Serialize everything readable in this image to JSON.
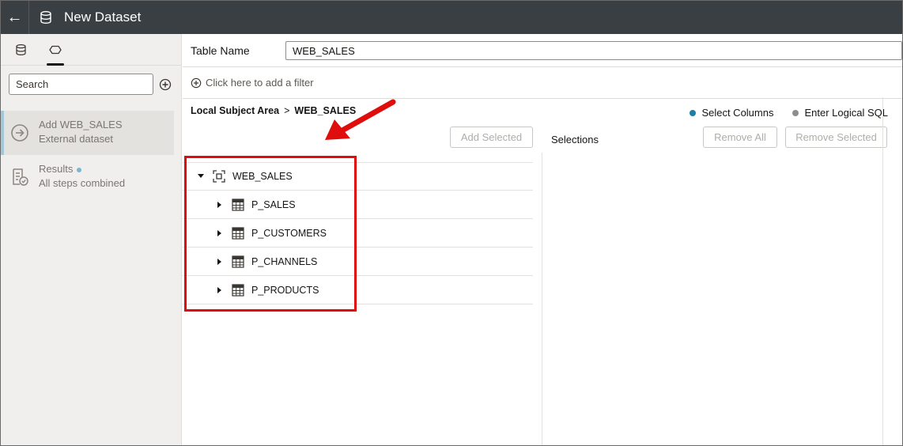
{
  "header": {
    "back_label": "←",
    "title": "New Dataset"
  },
  "left_panel": {
    "tabs": [
      "database-icon",
      "join-icon"
    ],
    "search_placeholder": "Search",
    "steps": [
      {
        "title": "Add WEB_SALES",
        "subtitle": "External dataset",
        "active": true
      },
      {
        "title": "Results",
        "subtitle": "All steps combined",
        "active": false
      }
    ]
  },
  "main": {
    "table_name_label": "Table Name",
    "table_name_value": "WEB_SALES",
    "filter_text": "Click here to add a filter",
    "breadcrumb": {
      "root": "Local Subject Area",
      "separator": ">",
      "current": "WEB_SALES"
    },
    "modes": [
      {
        "label": "Select Columns",
        "color": "#1f7fa4"
      },
      {
        "label": "Enter Logical SQL",
        "color": "#8e8c89"
      }
    ],
    "add_selected_label": "Add Selected",
    "selections_label": "Selections",
    "remove_all_label": "Remove All",
    "remove_selected_label": "Remove Selected",
    "tree": {
      "root": "WEB_SALES",
      "children": [
        "P_SALES",
        "P_CUSTOMERS",
        "P_CHANNELS",
        "P_PRODUCTS"
      ]
    }
  },
  "colors": {
    "header_bg": "#3a3f44",
    "highlight": "#e00d0d"
  }
}
